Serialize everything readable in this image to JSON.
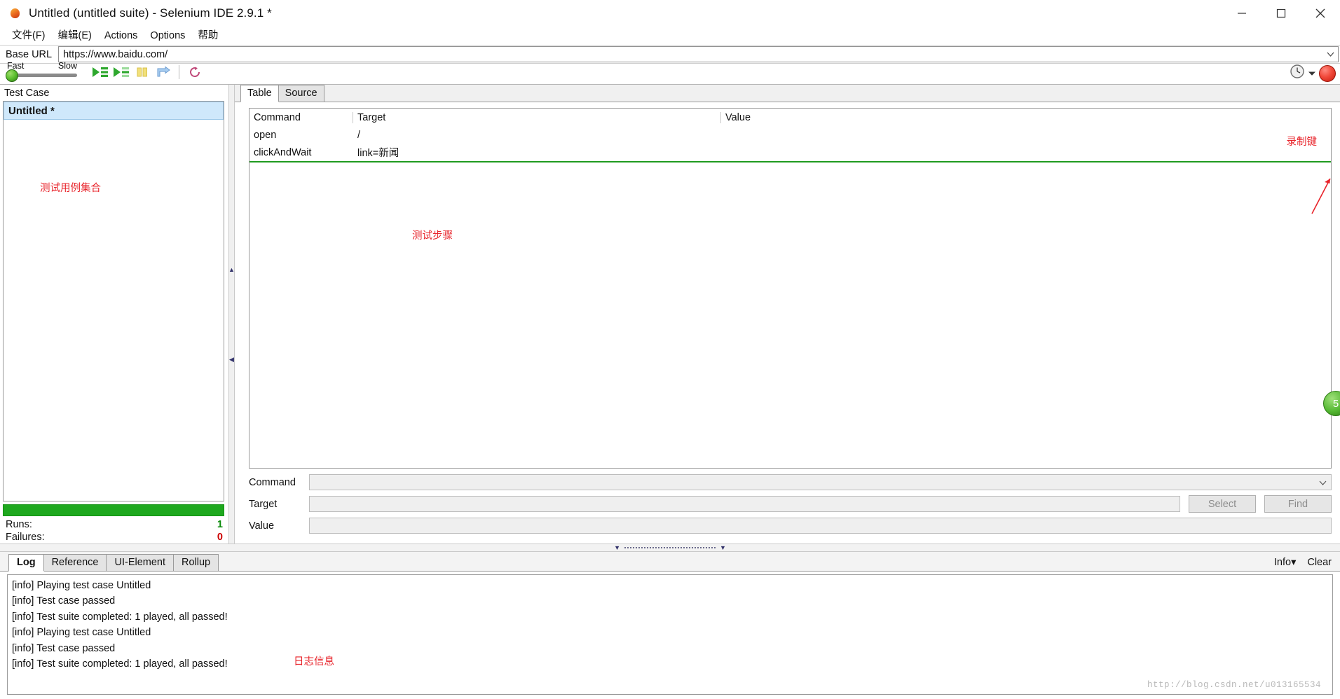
{
  "window": {
    "title": "Untitled (untitled suite) - Selenium IDE 2.9.1 *",
    "app_icon": "firefox-icon",
    "minimize": "minimize-icon",
    "maximize": "maximize-icon",
    "close": "close-icon"
  },
  "menu": {
    "items": [
      {
        "label": "文件(F)",
        "mnemonic": "F"
      },
      {
        "label": "编辑(E)",
        "mnemonic": "E"
      },
      {
        "label": "Actions",
        "mnemonic": "A"
      },
      {
        "label": "Options",
        "mnemonic": "O"
      },
      {
        "label": "帮助",
        "mnemonic": ""
      }
    ]
  },
  "base_url": {
    "label": "Base URL",
    "value": "https://www.baidu.com/",
    "placeholder": "",
    "dropdown_icon": "chevron-down-icon"
  },
  "toolbar": {
    "speed_fast_label": "Fast",
    "speed_slow_label": "Slow",
    "speed_value": "Fast",
    "buttons": [
      {
        "name": "play-entire-suite-button",
        "icon": "play-all-icon"
      },
      {
        "name": "play-current-test-button",
        "icon": "play-current-icon"
      },
      {
        "name": "pause-resume-button",
        "icon": "pause-icon"
      },
      {
        "name": "step-button",
        "icon": "step-icon"
      },
      {
        "name": "apply-rollup-button",
        "icon": "rollup-icon"
      }
    ],
    "schedule_icon": "clock-icon",
    "schedule_dropdown_icon": "chevron-down-icon",
    "record_button": "record-button"
  },
  "test_case_panel": {
    "header": "Test Case",
    "items": [
      {
        "label": "Untitled *",
        "selected": true
      }
    ],
    "annotation": "测试用例集合",
    "progress_percent": 100,
    "stats": [
      {
        "label": "Runs:",
        "value": "1",
        "color": "#0a8a0a"
      },
      {
        "label": "Failures:",
        "value": "0",
        "color": "#cc0000"
      }
    ]
  },
  "editor": {
    "tabs": [
      {
        "label": "Table",
        "active": true
      },
      {
        "label": "Source",
        "active": false
      }
    ],
    "columns": [
      "Command",
      "Target",
      "Value"
    ],
    "rows": [
      {
        "command": "open",
        "target": "/",
        "value": ""
      },
      {
        "command": "clickAndWait",
        "target": "link=新闻",
        "value": ""
      }
    ],
    "annotation": "测试步骤",
    "record_annotation": "录制键"
  },
  "command_form": {
    "fields": [
      {
        "label": "Command",
        "value": "",
        "placeholder": "",
        "has_dropdown": true
      },
      {
        "label": "Target",
        "value": "",
        "placeholder": "",
        "has_dropdown": false
      },
      {
        "label": "Value",
        "value": "",
        "placeholder": "",
        "has_dropdown": false
      }
    ],
    "select_button": "Select",
    "find_button": "Find"
  },
  "log_panel": {
    "tabs": [
      {
        "label": "Log",
        "active": true
      },
      {
        "label": "Reference",
        "active": false
      },
      {
        "label": "UI-Element",
        "active": false
      },
      {
        "label": "Rollup",
        "active": false
      }
    ],
    "info_label": "Info",
    "info_dropdown_icon": "chevron-down-icon",
    "clear_label": "Clear",
    "lines": [
      "[info] Playing test case Untitled",
      "[info] Test case passed",
      "[info] Test suite completed: 1 played, all passed!",
      "[info] Playing test case Untitled",
      "[info] Test case passed",
      "[info] Test suite completed: 1 played, all passed!"
    ],
    "annotation": "日志信息",
    "watermark": "http://blog.csdn.net/u013165534"
  },
  "side_badge": {
    "label": "5"
  },
  "colors": {
    "annotation_red": "#e8232a",
    "progress_green": "#1ea81e",
    "selection_blue": "#cfe8fb",
    "record_red": "#f24b3c"
  }
}
